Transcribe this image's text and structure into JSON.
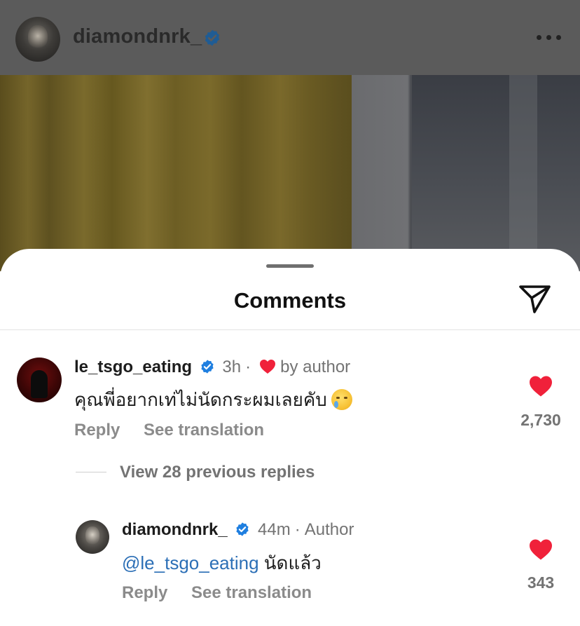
{
  "post": {
    "author_username": "diamondnrk_"
  },
  "comments_sheet": {
    "title": "Comments",
    "comment": {
      "username": "le_tsgo_eating",
      "time": "3h",
      "liked_by_author_label": "by author",
      "text": "คุณพี่อยากเท่ไม่นัดกระผมเลยคับ",
      "like_count": "2,730",
      "reply_label": "Reply",
      "see_translation_label": "See translation"
    },
    "view_replies_label": "View 28 previous replies",
    "reply": {
      "username": "diamondnrk_",
      "time": "44m",
      "author_label": "Author",
      "mention": "@le_tsgo_eating",
      "text": "นัดแล้ว",
      "like_count": "343",
      "reply_label": "Reply",
      "see_translation_label": "See translation"
    }
  },
  "colors": {
    "verified_blue": "#1f7fe0",
    "like_red": "#f0213a",
    "mention_blue": "#2c6fb6"
  },
  "icons": [
    "verified-icon",
    "more-icon",
    "share-icon",
    "heart-icon",
    "crying-emoji"
  ]
}
